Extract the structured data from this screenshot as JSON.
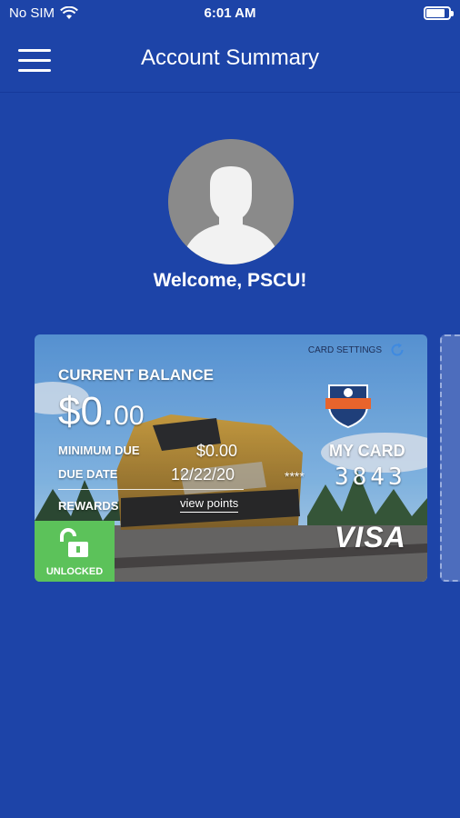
{
  "status_bar": {
    "carrier": "No SIM",
    "time": "6:01 AM",
    "battery_level": 0.85
  },
  "header": {
    "title": "Account Summary",
    "menu_icon": "hamburger-menu-icon"
  },
  "profile": {
    "welcome": "Welcome, PSCU!"
  },
  "card": {
    "settings_label": "CARD SETTINGS",
    "current_balance_label": "CURRENT BALANCE",
    "balance_main": "$0.",
    "balance_cents": "00",
    "minimum_due_label": "MINIMUM DUE",
    "minimum_due_value": "$0.00",
    "due_date_label": "DUE DATE",
    "due_date_value": "12/22/20",
    "rewards_label": "REWARDS",
    "view_points_label": "view points",
    "my_card_label": "MY CARD",
    "masked_digits": "****",
    "last_four": "3843",
    "network": "VISA",
    "lock_status": "UNLOCKED"
  },
  "colors": {
    "background": "#1d44a8",
    "unlocked_green": "#5cc25a",
    "avatar_grey": "#8a8a8a"
  }
}
